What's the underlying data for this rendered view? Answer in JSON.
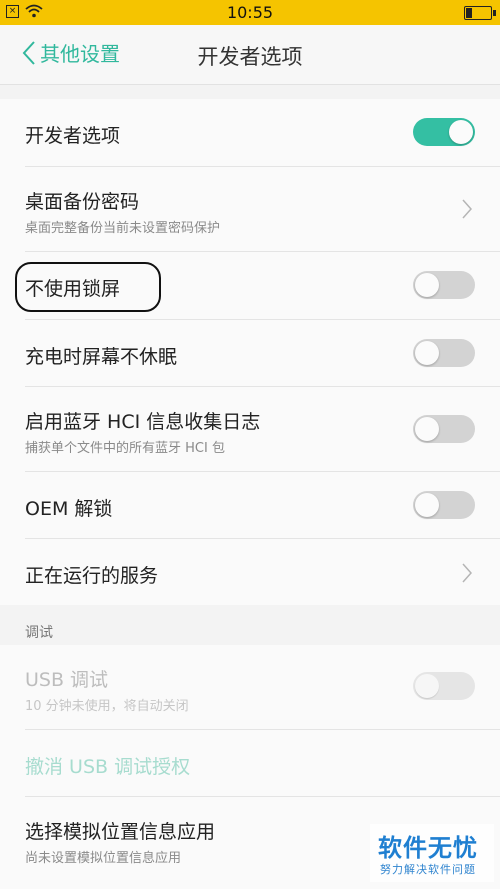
{
  "status_bar": {
    "time": "10:55",
    "notification_icon": "close-box-icon",
    "wifi_icon": "wifi-icon",
    "battery_icon": "battery-icon",
    "background_color": "#f5c400"
  },
  "nav": {
    "back_label": "其他设置",
    "title": "开发者选项",
    "accent_color": "#31b89d"
  },
  "settings": {
    "developer_options": {
      "title": "开发者选项",
      "toggle": "on"
    },
    "desktop_backup_password": {
      "title": "桌面备份密码",
      "subtitle": "桌面完整备份当前未设置密码保护"
    },
    "no_lock_screen": {
      "title": "不使用锁屏",
      "toggle": "off"
    },
    "stay_awake": {
      "title": "充电时屏幕不休眠",
      "toggle": "off"
    },
    "bt_hci_log": {
      "title": "启用蓝牙 HCI 信息收集日志",
      "subtitle": "捕获单个文件中的所有蓝牙 HCI 包",
      "toggle": "off"
    },
    "oem_unlock": {
      "title": "OEM 解锁",
      "toggle": "off"
    },
    "running_services": {
      "title": "正在运行的服务"
    }
  },
  "debug_section": {
    "label": "调试",
    "usb_debugging": {
      "title": "USB 调试",
      "subtitle": "10 分钟未使用，将自动关闭",
      "toggle": "off",
      "enabled": false
    },
    "revoke_usb_auth": {
      "title": "撤消 USB 调试授权"
    },
    "mock_location_app": {
      "title": "选择模拟位置信息应用",
      "subtitle": "尚未设置模拟位置信息应用"
    }
  },
  "toggle_on_color": "#34bfa3",
  "watermark": {
    "main": "软件无忧",
    "sub": "努力解决软件问题"
  }
}
